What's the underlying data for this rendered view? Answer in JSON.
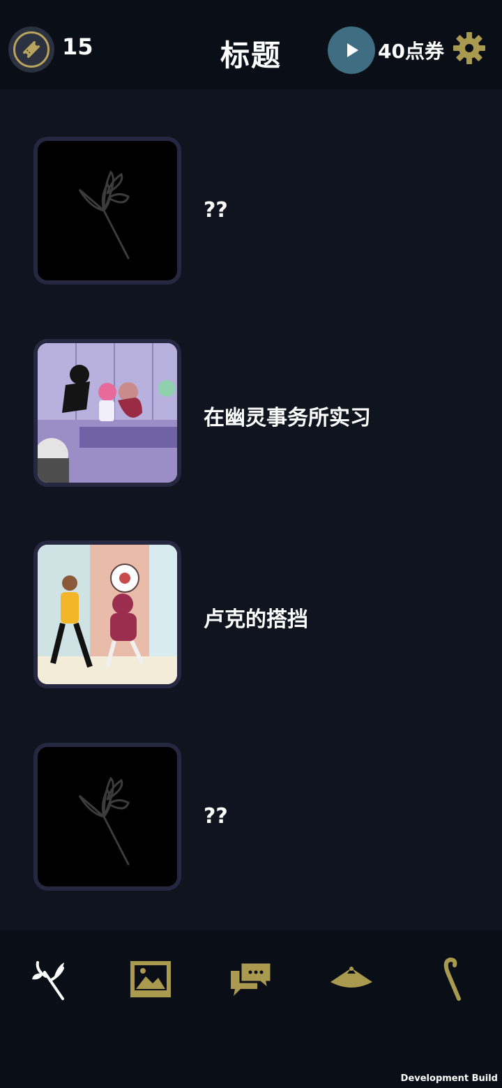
{
  "header": {
    "ticket_count": "15",
    "title": "标题",
    "points": "40点券"
  },
  "stories": [
    {
      "title": "??",
      "locked": true
    },
    {
      "title": "在幽灵事务所实习",
      "locked": false
    },
    {
      "title": "卢克的搭挡",
      "locked": false
    },
    {
      "title": "??",
      "locked": true
    }
  ],
  "bottom_nav": [
    "flower-icon",
    "gallery-icon",
    "chat-icon",
    "hat-icon",
    "cane-icon"
  ],
  "footer": {
    "build_label": "Development Build"
  },
  "colors": {
    "accent_gold": "#a99a4f",
    "play_blue": "#3f6e82",
    "background": "#10141e"
  }
}
